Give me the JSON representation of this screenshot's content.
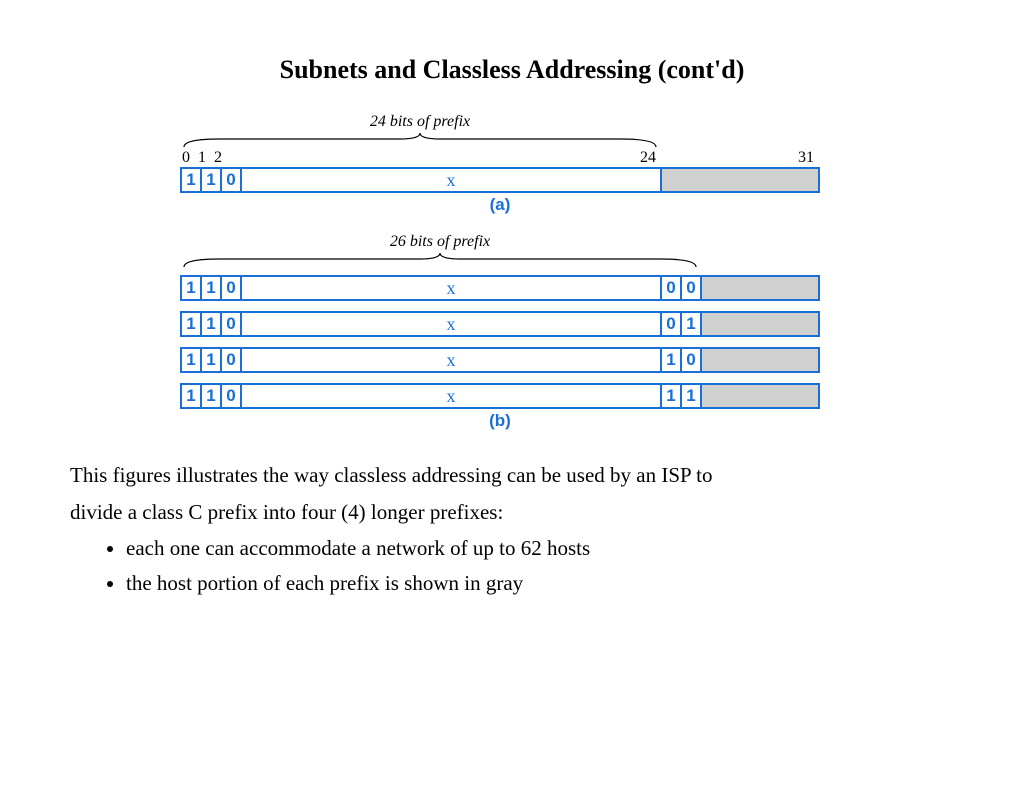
{
  "title": "Subnets and Classless Addressing (cont'd)",
  "figA": {
    "caption": "24 bits of prefix",
    "ticks": {
      "t0": "0",
      "t1": "1",
      "t2": "2",
      "t24": "24",
      "t31": "31"
    },
    "bits": {
      "b0": "1",
      "b1": "1",
      "b2": "0"
    },
    "x": "x",
    "label": "(a)"
  },
  "figB": {
    "caption": "26 bits of prefix",
    "row1": {
      "b0": "1",
      "b1": "1",
      "b2": "0",
      "x": "x",
      "s0": "0",
      "s1": "0"
    },
    "row2": {
      "b0": "1",
      "b1": "1",
      "b2": "0",
      "x": "x",
      "s0": "0",
      "s1": "1"
    },
    "row3": {
      "b0": "1",
      "b1": "1",
      "b2": "0",
      "x": "x",
      "s0": "1",
      "s1": "0"
    },
    "row4": {
      "b0": "1",
      "b1": "1",
      "b2": "0",
      "x": "x",
      "s0": "1",
      "s1": "1"
    },
    "label": "(b)"
  },
  "para": {
    "line1": "This figures illustrates the way classless addressing can be used by an ISP to",
    "line2": "divide a class C prefix into four (4) longer prefixes:",
    "bullet1": "each one can accommodate a network of up to 62 hosts",
    "bullet2": "the host portion of each prefix is shown in gray"
  }
}
